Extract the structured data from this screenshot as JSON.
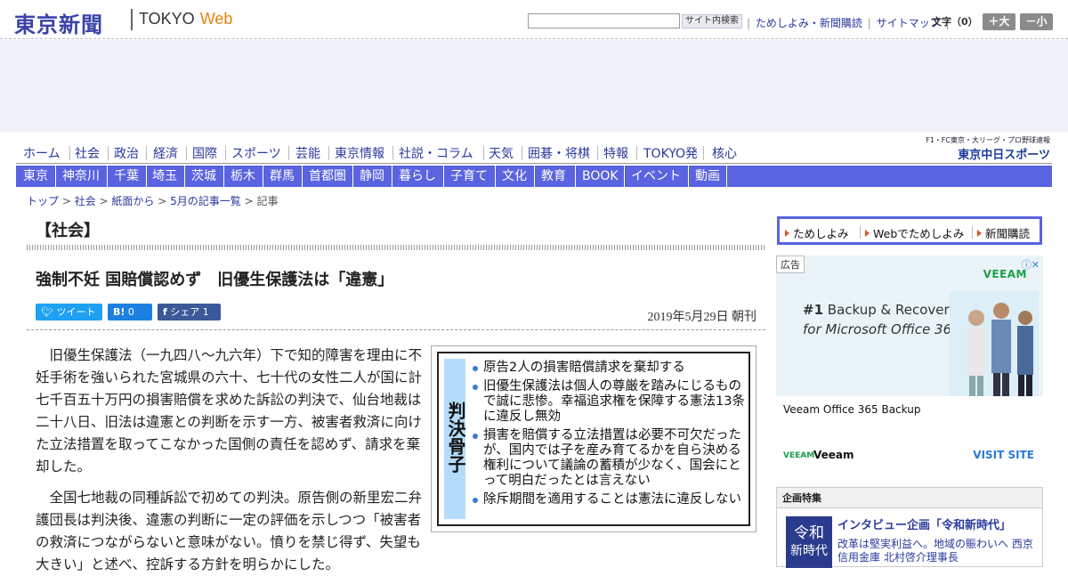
{
  "header": {
    "logo_jp": "東京新聞",
    "logo_en_a": "TOKYO",
    "logo_en_b": "Web",
    "search_button": "サイト内検索",
    "links": [
      "ためしよみ・新聞購読",
      "サイトマップ"
    ],
    "font_size_label": "文字（0）",
    "font_bigger": "＋大",
    "font_smaller": "－小"
  },
  "nav_main": [
    "ホーム",
    "社会",
    "政治",
    "経済",
    "国際",
    "スポーツ",
    "芸能",
    "東京情報",
    "社説・コラム",
    "天気",
    "囲碁・将棋",
    "特報",
    "TOKYO発",
    "核心"
  ],
  "chunichi": {
    "line1": "F1・FC東京・大リーグ・プロ野球速報",
    "line2": "東京中日スポーツ"
  },
  "nav_region": [
    "東京",
    "神奈川",
    "千葉",
    "埼玉",
    "茨城",
    "栃木",
    "群馬",
    "首都圏",
    "静岡",
    "暮らし",
    "子育て",
    "文化",
    "教育",
    "BOOK",
    "イベント",
    "動画"
  ],
  "breadcrumb": {
    "items": [
      "トップ",
      "社会",
      "紙面から",
      "5月の記事一覧"
    ],
    "current": "記事"
  },
  "section_title": "【社会】",
  "article": {
    "headline": "強制不妊 国賠償認めず　旧優生保護法は「違憲」",
    "share": {
      "tweet": "ツイート",
      "hatena_count": "0",
      "facebook": "シェア",
      "facebook_count": "1"
    },
    "date": "2019年5月29日 朝刊",
    "paragraphs": [
      "旧優生保護法（一九四八～九六年）下で知的障害を理由に不妊手術を強いられた宮城県の六十、七十代の女性二人が国に計七千百五十万円の損害賠償を求めた訴訟の判決で、仙台地裁は二十八日、旧法は違憲との判断を示す一方、被害者救済に向けた立法措置を取ってこなかった国側の責任を認めず、請求を棄却した。",
      "全国七地裁の同種訴訟で初めての判決。原告側の新里宏二弁護団長は判決後、違憲の判断に一定の評価を示しつつ「被害者の救済につながらないと意味がない。憤りを禁じ得ず、失望も大きい」と述べ、控訴する方針を明らかにした。"
    ],
    "figure": {
      "title": "判決骨子",
      "points": [
        "原告2人の損害賠償請求を棄却する",
        "旧優生保護法は個人の尊厳を踏みにじるもので誠に悲惨。幸福追求権を保障する憲法13条に違反し無効",
        "損害を賠償する立法措置は必要不可欠だったが、国内では子を産み育てるかを自ら決める権利について議論の蓄積が少なく、国会にとって明白だったとは言えない",
        "除斥期間を適用することは憲法に違反しない"
      ]
    }
  },
  "sidebar": {
    "buttons": [
      "ためしよみ",
      "Webでためしよみ",
      "新聞購読"
    ],
    "ad": {
      "label": "広告",
      "brand": "VEEAM",
      "headline_a": "#1",
      "headline_b": "Backup & Recovery",
      "headline_c": "for Microsoft Office 365",
      "caption": "Veeam Office 365 Backup",
      "footer_brand_small": "VEEAM",
      "footer_brand": "Veeam",
      "cta": "VISIT SITE"
    },
    "feature": {
      "heading": "企画特集",
      "thumb_1": "令和",
      "thumb_2": "新時代",
      "title": "インタビュー企画「令和新時代」",
      "summary": "改革は堅実利益へ。地域の賑わいへ 西京信用金庫 北村啓介理事長"
    }
  }
}
